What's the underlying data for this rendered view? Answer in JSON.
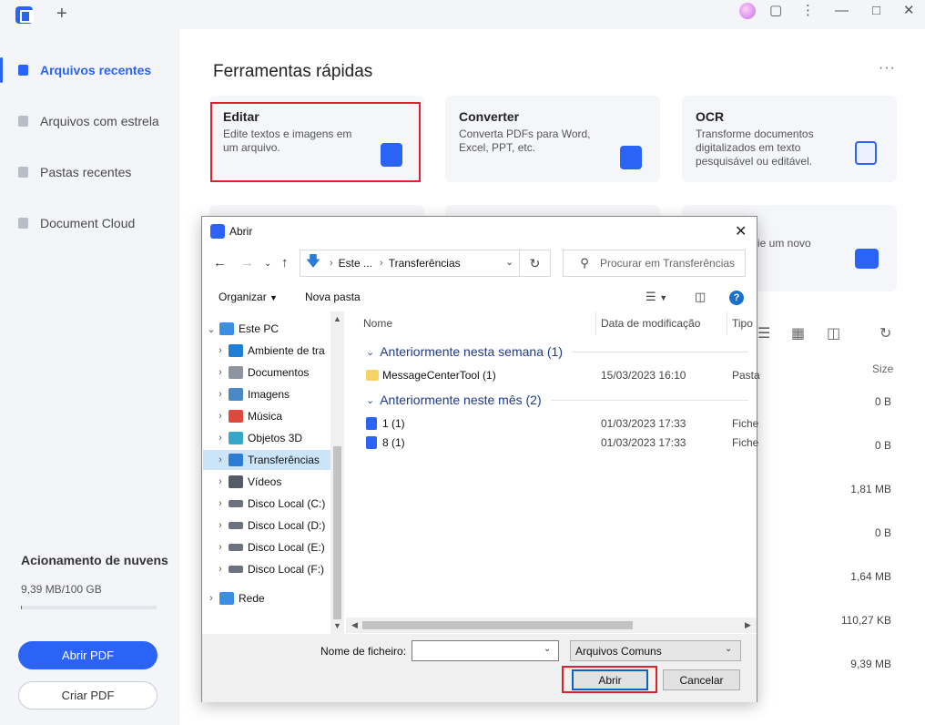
{
  "sidebar": {
    "items": [
      {
        "label": "Arquivos recentes"
      },
      {
        "label": "Arquivos com estrela"
      },
      {
        "label": "Pastas recentes"
      },
      {
        "label": "Document Cloud"
      }
    ],
    "cloud_title": "Acionamento de nuvens",
    "cloud_usage": "9,39 MB/100 GB",
    "cloud_usage_fraction": 0.0001,
    "open_button": "Abrir PDF",
    "create_button": "Criar PDF"
  },
  "main": {
    "title": "Ferramentas rápidas",
    "cards": [
      {
        "title": "Editar",
        "desc": "Edite textos e imagens em um arquivo."
      },
      {
        "title": "Converter",
        "desc": "Converta PDFs para Word, Excel, PPT, etc."
      },
      {
        "title": "OCR",
        "desc": "Transforme documentos digitalizados em texto pesquisável ou editável."
      }
    ],
    "partial_card_text": "rie um novo",
    "size_header": "Size",
    "sizes": [
      "0 B",
      "0 B",
      "1,81 MB",
      "0 B",
      "1,64 MB",
      "110,27 KB",
      "9,39 MB"
    ]
  },
  "dialog": {
    "title": "Abrir",
    "address": {
      "seg1": "Este ...",
      "seg2": "Transferências"
    },
    "search_placeholder": "Procurar em Transferências",
    "organize": "Organizar",
    "new_folder": "Nova pasta",
    "tree": [
      {
        "label": "Este PC",
        "color": "#3a8ee6"
      },
      {
        "label": "Ambiente de tra",
        "color": "#1f7fd6"
      },
      {
        "label": "Documentos",
        "color": "#8f959e"
      },
      {
        "label": "Imagens",
        "color": "#4a88c7"
      },
      {
        "label": "Música",
        "color": "#e0483e"
      },
      {
        "label": "Objetos 3D",
        "color": "#37a7c9"
      },
      {
        "label": "Transferências",
        "color": "#2b7cd6"
      },
      {
        "label": "Vídeos",
        "color": "#555b66"
      },
      {
        "label": "Disco Local (C:)",
        "color": "#6b7280"
      },
      {
        "label": "Disco Local (D:)",
        "color": "#6b7280"
      },
      {
        "label": "Disco Local (E:)",
        "color": "#6b7280"
      },
      {
        "label": "Disco Local (F:)",
        "color": "#6b7280"
      },
      {
        "label": "Rede",
        "color": "#3a8ee6"
      }
    ],
    "columns": {
      "name": "Nome",
      "date": "Data de modificação",
      "type": "Tipo"
    },
    "groups": [
      {
        "label": "Anteriormente nesta semana (1)",
        "files": [
          {
            "name": "MessageCenterTool (1)",
            "date": "15/03/2023 16:10",
            "type": "Pasta"
          }
        ]
      },
      {
        "label": "Anteriormente neste mês (2)",
        "files": [
          {
            "name": "1 (1)",
            "date": "01/03/2023 17:33",
            "type": "Fiche"
          },
          {
            "name": "8 (1)",
            "date": "01/03/2023 17:33",
            "type": "Fiche"
          }
        ]
      }
    ],
    "filename_label": "Nome de ficheiro:",
    "filename_value": "",
    "filter": "Arquivos Comuns",
    "open_button": "Abrir",
    "cancel_button": "Cancelar"
  },
  "colors": {
    "accent": "#2b63f6",
    "highlight": "#e0202a",
    "selected": "#cce4f7"
  }
}
